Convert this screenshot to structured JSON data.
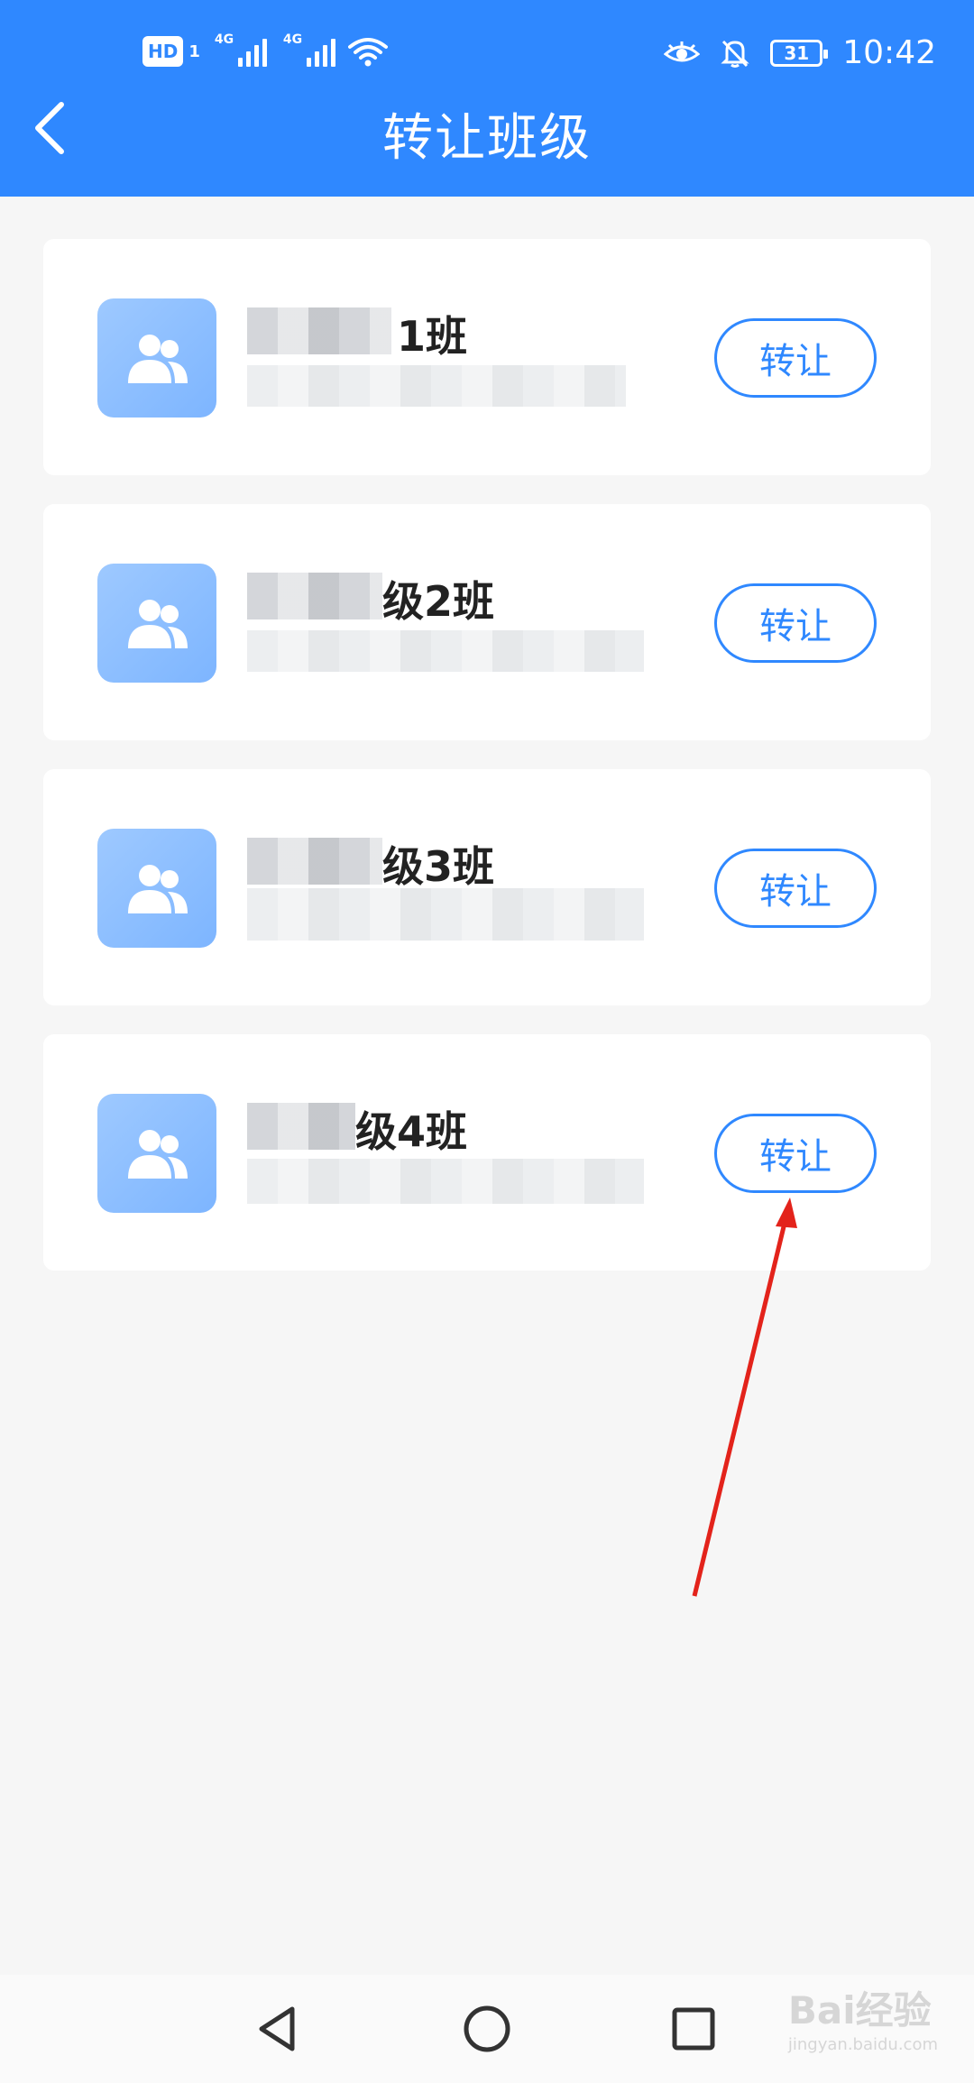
{
  "status_bar": {
    "hd_label": "HD",
    "hd_sim": "1",
    "signal_1_label": "4G",
    "signal_2_label": "4G",
    "battery": "31",
    "time": "10:42"
  },
  "header": {
    "title": "转让班级",
    "back_icon": "chevron-left-icon"
  },
  "classes": [
    {
      "name_visible": "1班",
      "button_label": "转让"
    },
    {
      "name_visible": "级2班",
      "button_label": "转让"
    },
    {
      "name_visible": "级3班",
      "button_label": "转让"
    },
    {
      "name_visible": "级4班",
      "button_label": "转让"
    }
  ],
  "colors": {
    "accent": "#2f88ff",
    "annotation": "#e3231b"
  },
  "watermark": {
    "text": "Bai经验",
    "sub": "jingyan.baidu.com"
  }
}
